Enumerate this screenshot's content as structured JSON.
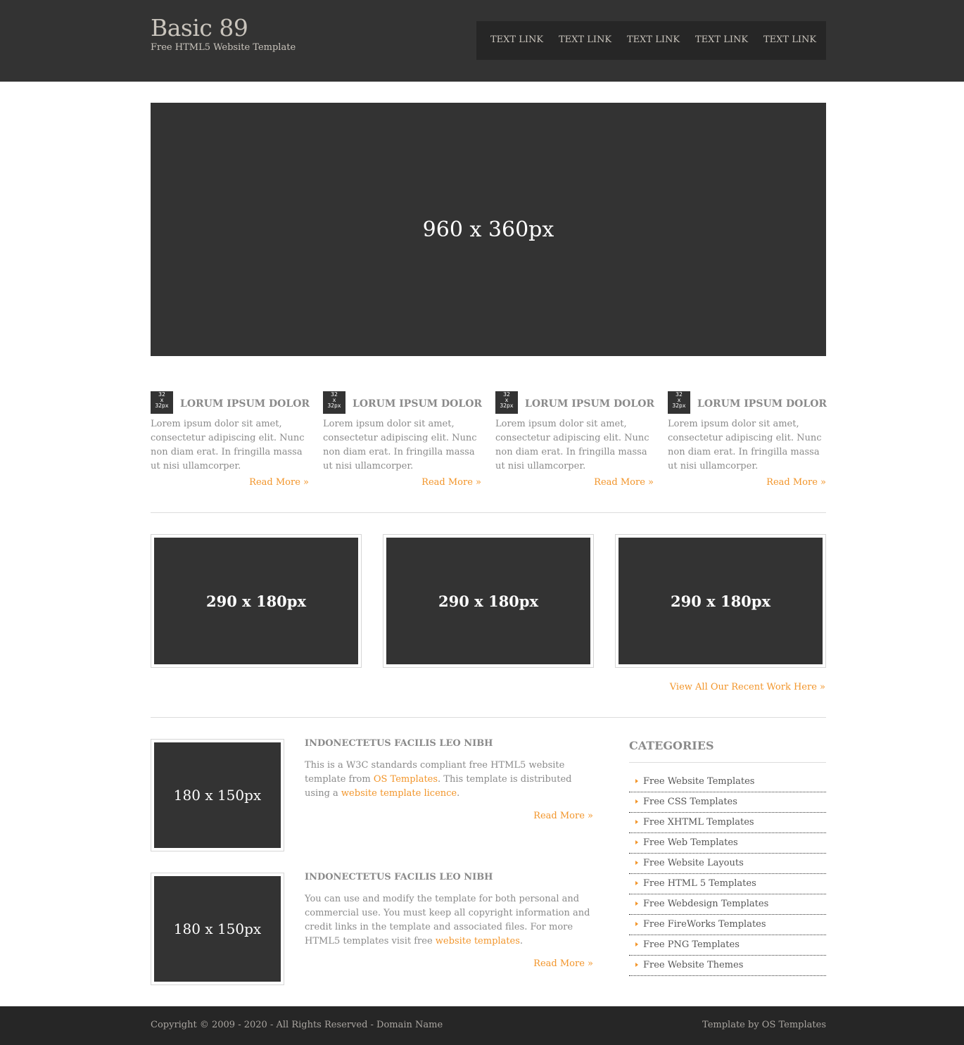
{
  "header": {
    "title": "Basic 89",
    "tagline": "Free HTML5 Website Template",
    "nav": [
      "TEXT LINK",
      "TEXT LINK",
      "TEXT LINK",
      "TEXT LINK",
      "TEXT LINK"
    ]
  },
  "hero": {
    "label": "960 x 360px"
  },
  "features": [
    {
      "icon": "32\nx\n32px",
      "title": "LORUM IPSUM DOLOR",
      "text": "Lorem ipsum dolor sit amet, consectetur adipiscing elit. Nunc non diam erat. In fringilla massa ut nisi ullamcorper.",
      "more": "Read More »"
    },
    {
      "icon": "32\nx\n32px",
      "title": "LORUM IPSUM DOLOR",
      "text": "Lorem ipsum dolor sit amet, consectetur adipiscing elit. Nunc non diam erat. In fringilla massa ut nisi ullamcorper.",
      "more": "Read More »"
    },
    {
      "icon": "32\nx\n32px",
      "title": "LORUM IPSUM DOLOR",
      "text": "Lorem ipsum dolor sit amet, consectetur adipiscing elit. Nunc non diam erat. In fringilla massa ut nisi ullamcorper.",
      "more": "Read More »"
    },
    {
      "icon": "32\nx\n32px",
      "title": "LORUM IPSUM DOLOR",
      "text": "Lorem ipsum dolor sit amet, consectetur adipiscing elit. Nunc non diam erat. In fringilla massa ut nisi ullamcorper.",
      "more": "Read More »"
    }
  ],
  "gallery": {
    "items": [
      "290 x 180px",
      "290 x 180px",
      "290 x 180px"
    ],
    "view_all": "View All Our Recent Work Here »"
  },
  "posts": [
    {
      "image": "180 x 150px",
      "title": "INDONECTETUS FACILIS LEO NIBH",
      "text_a": "This is a W3C standards compliant free HTML5 website template from ",
      "link_a": "OS Templates",
      "text_b": ". This template is distributed using a ",
      "link_b": "website template licence",
      "text_c": ".",
      "more": "Read More »"
    },
    {
      "image": "180 x 150px",
      "title": "INDONECTETUS FACILIS LEO NIBH",
      "text_a": "You can use and modify the template for both personal and commercial use. You must keep all copyright information and credit links in the template and associated files. For more HTML5 templates visit free ",
      "link_a": "website templates",
      "text_b": ".",
      "more": "Read More »"
    }
  ],
  "categories": {
    "title": "CATEGORIES",
    "items": [
      "Free Website Templates",
      "Free CSS Templates",
      "Free XHTML Templates",
      "Free Web Templates",
      "Free Website Layouts",
      "Free HTML 5 Templates",
      "Free Webdesign Templates",
      "Free FireWorks Templates",
      "Free PNG Templates",
      "Free Website Themes"
    ]
  },
  "footer": {
    "copyright": "Copyright © 2009 - 2020 - All Rights Reserved - Domain Name",
    "credit": "Template by OS Templates"
  },
  "colors": {
    "dark": "#333333",
    "footer": "#262626",
    "accent": "#f2952a",
    "text": "#8a8a8a"
  }
}
